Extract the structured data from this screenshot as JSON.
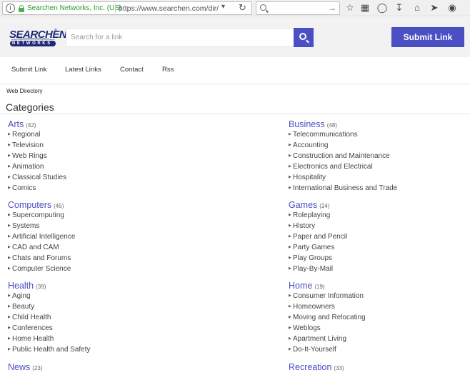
{
  "browser": {
    "site_identity": "Searchen Networks, Inc. (US)",
    "url": "https://www.searchen.com/dir/",
    "info_glyph": "i",
    "icons": [
      "info-icon",
      "lock-icon",
      "dropdown-icon",
      "reload-icon",
      "search-icon",
      "go-arrow-icon",
      "bookmark-star-icon",
      "reading-list-icon",
      "pocket-icon",
      "download-icon",
      "home-icon",
      "send-icon",
      "extension-icon"
    ]
  },
  "header": {
    "logo_text": "SEARCHEN",
    "logo_subtext": "NETWORKS",
    "search_placeholder": "Search for a link",
    "submit_label": "Submit Link"
  },
  "nav": {
    "items": [
      "Submit Link",
      "Latest Links",
      "Contact",
      "Rss"
    ]
  },
  "breadcrumb": "Web Directory",
  "categories_title": "Categories",
  "categories": {
    "left": [
      {
        "name": "Arts",
        "count": "(42)",
        "items": [
          "Regional",
          "Television",
          "Web Rings",
          "Animation",
          "Classical Studies",
          "Comics"
        ]
      },
      {
        "name": "Computers",
        "count": "(45)",
        "items": [
          "Supercomputing",
          "Systems",
          "Artificial Intelligence",
          "CAD and CAM",
          "Chats and Forums",
          "Computer Science"
        ]
      },
      {
        "name": "Health",
        "count": "(39)",
        "items": [
          "Aging",
          "Beauty",
          "Child Health",
          "Conferences",
          "Home Health",
          "Public Health and Safety"
        ]
      },
      {
        "name": "News",
        "count": "(23)",
        "items": []
      }
    ],
    "right": [
      {
        "name": "Business",
        "count": "(48)",
        "items": [
          "Telecommunications",
          "Accounting",
          "Construction and Maintenance",
          "Electronics and Electrical",
          "Hospitality",
          "International Business and Trade"
        ]
      },
      {
        "name": "Games",
        "count": "(24)",
        "items": [
          "Roleplaying",
          "History",
          "Paper and Pencil",
          "Party Games",
          "Play Groups",
          "Play-By-Mail"
        ]
      },
      {
        "name": "Home",
        "count": "(19)",
        "items": [
          "Consumer Information",
          "Homeowners",
          "Moving and Relocating",
          "Weblogs",
          "Apartment Living",
          "Do-It-Yourself"
        ]
      },
      {
        "name": "Recreation",
        "count": "(33)",
        "items": []
      }
    ]
  },
  "colors": {
    "accent": "#4a4fc4",
    "logo": "#1e2a78",
    "secure": "#2e9a2e"
  }
}
